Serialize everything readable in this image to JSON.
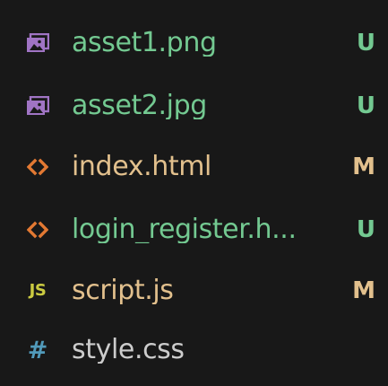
{
  "explorer": {
    "files": [
      {
        "name": "asset1.png",
        "status": "U",
        "icon": "image-icon"
      },
      {
        "name": "asset2.jpg",
        "status": "U",
        "icon": "image-icon"
      },
      {
        "name": "index.html",
        "status": "M",
        "icon": "html-icon"
      },
      {
        "name": "login_register.h...",
        "status": "U",
        "icon": "html-icon"
      },
      {
        "name": "script.js",
        "status": "M",
        "icon": "js-icon",
        "icon_text": "JS"
      },
      {
        "name": "style.css",
        "status": "",
        "icon": "css-icon",
        "icon_text": "#"
      }
    ],
    "colors": {
      "background": "#181818",
      "untracked_text": "#73c991",
      "modified_text": "#e2c08d",
      "default_text": "#cccccc",
      "image_icon": "#a074c4",
      "html_icon": "#e37933",
      "js_icon": "#cbcb41",
      "css_icon": "#519aba"
    }
  }
}
